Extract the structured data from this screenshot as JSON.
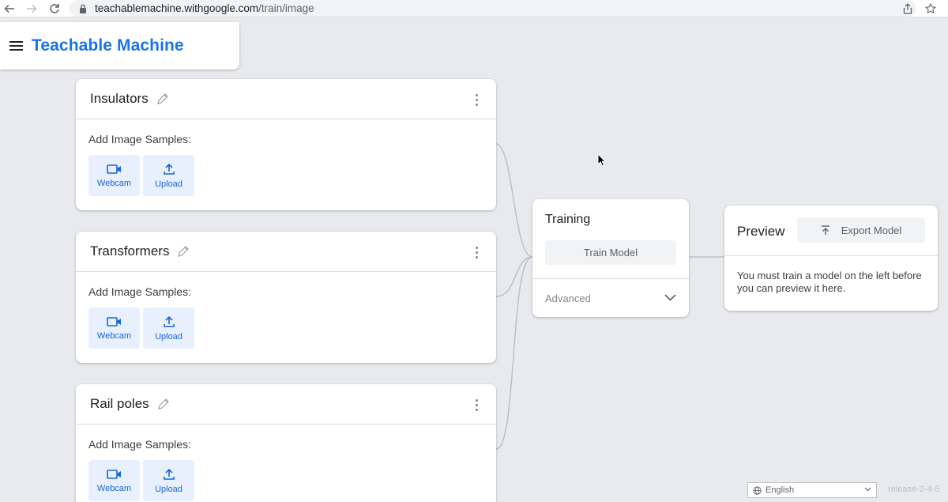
{
  "browser": {
    "url_host": "teachablemachine.withgoogle.com",
    "url_path": "/train/image"
  },
  "app": {
    "title": "Teachable Machine"
  },
  "classes": [
    {
      "name": "Insulators",
      "samples_label": "Add Image Samples:",
      "webcam_label": "Webcam",
      "upload_label": "Upload"
    },
    {
      "name": "Transformers",
      "samples_label": "Add Image Samples:",
      "webcam_label": "Webcam",
      "upload_label": "Upload"
    },
    {
      "name": "Rail poles",
      "samples_label": "Add Image Samples:",
      "webcam_label": "Webcam",
      "upload_label": "Upload"
    }
  ],
  "training": {
    "title": "Training",
    "train_button": "Train Model",
    "advanced_label": "Advanced"
  },
  "preview": {
    "title": "Preview",
    "export_button": "Export Model",
    "message": "You must train a model on the left before you can preview it here."
  },
  "footer": {
    "language": "English",
    "release": "release-2-4-5"
  },
  "colors": {
    "brand": "#1a73e8",
    "sample_button_bg": "#e8f0fe",
    "sample_button_fg": "#1967d2",
    "page_bg": "#e8eaed"
  }
}
